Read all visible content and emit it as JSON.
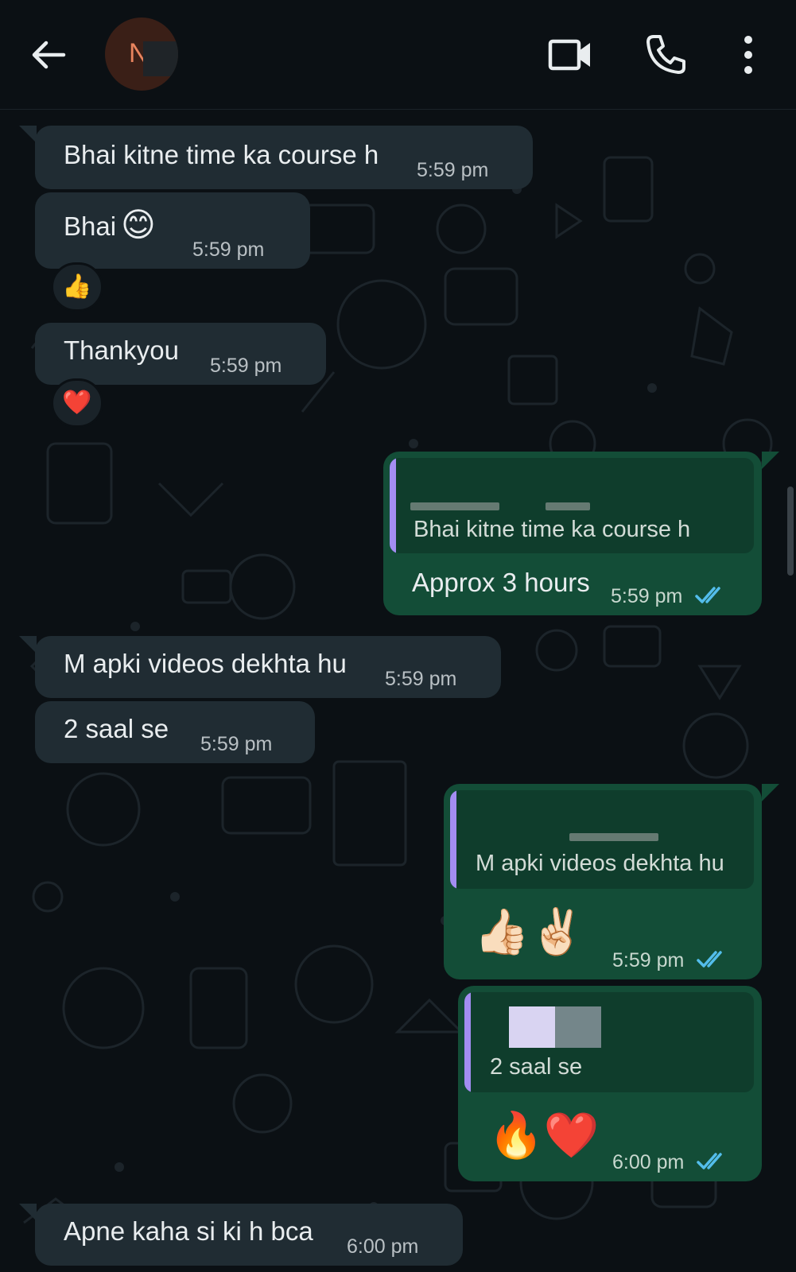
{
  "header": {
    "back_icon": "arrow-left-icon",
    "avatar_initial": "N",
    "contact_name": "",
    "icons": [
      "video-camera-icon",
      "phone-icon",
      "more-vert-icon"
    ]
  },
  "colors": {
    "background": "#0b1014",
    "incoming_bubble": "#202c33",
    "outgoing_bubble": "#134d37",
    "quote_bar": "#a38df2",
    "read_ticks": "#53bdeb"
  },
  "messages": [
    {
      "direction": "in",
      "text": "Bhai kitne time ka course h",
      "time": "5:59 pm"
    },
    {
      "direction": "in",
      "text": "Bhai",
      "emoji": "😊",
      "time": "5:59 pm",
      "reaction": "👍"
    },
    {
      "direction": "in",
      "text": "Thankyou",
      "time": "5:59 pm",
      "reaction": "❤️"
    },
    {
      "direction": "out",
      "quote": "Bhai kitne time ka course h",
      "text": "Approx 3 hours",
      "time": "5:59 pm",
      "status": "read"
    },
    {
      "direction": "in",
      "text": "M apki videos dekhta hu",
      "time": "5:59 pm"
    },
    {
      "direction": "in",
      "text": "2 saal se",
      "time": "5:59 pm"
    },
    {
      "direction": "out",
      "quote": "M apki videos dekhta hu",
      "text": "👍🏻✌🏻",
      "time": "5:59 pm",
      "status": "read"
    },
    {
      "direction": "out",
      "quote": "2 saal se",
      "text": "🔥❤️",
      "time": "6:00 pm",
      "status": "read"
    },
    {
      "direction": "in",
      "text": "Apne kaha si ki h bca",
      "time": "6:00 pm"
    }
  ]
}
